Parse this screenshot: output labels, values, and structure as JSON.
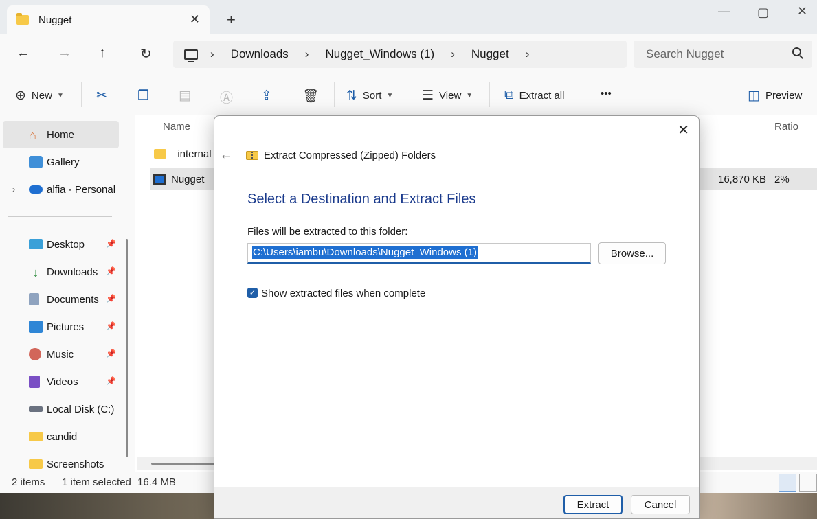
{
  "tab": {
    "title": "Nugget"
  },
  "breadcrumb": [
    "Downloads",
    "Nugget_Windows (1)",
    "Nugget"
  ],
  "search": {
    "placeholder": "Search Nugget"
  },
  "toolbar": {
    "new_label": "New",
    "sort_label": "Sort",
    "view_label": "View",
    "extract_all_label": "Extract all",
    "more_label": "•••",
    "preview_label": "Preview"
  },
  "sidebar": {
    "items": [
      {
        "label": "Home",
        "icon": "home-icon"
      },
      {
        "label": "Gallery",
        "icon": "gallery-icon"
      },
      {
        "label": "alfia - Personal",
        "icon": "onedrive-icon"
      },
      {
        "label": "Desktop",
        "icon": "desktop-icon"
      },
      {
        "label": "Downloads",
        "icon": "downloads-icon"
      },
      {
        "label": "Documents",
        "icon": "documents-icon"
      },
      {
        "label": "Pictures",
        "icon": "pictures-icon"
      },
      {
        "label": "Music",
        "icon": "music-icon"
      },
      {
        "label": "Videos",
        "icon": "videos-icon"
      },
      {
        "label": "Local Disk (C:)",
        "icon": "drive-icon"
      },
      {
        "label": "candid",
        "icon": "folder-icon"
      },
      {
        "label": "Screenshots",
        "icon": "folder-icon"
      }
    ]
  },
  "filelist": {
    "columns": {
      "name": "Name",
      "ratio": "Ratio"
    },
    "rows": [
      {
        "name": "_internal",
        "size": "",
        "ratio": ""
      },
      {
        "name": "Nugget",
        "size": "16,870 KB",
        "ratio": "2%"
      }
    ]
  },
  "status": {
    "count": "2 items",
    "selected": "1 item selected",
    "size": "16.4 MB"
  },
  "dialog": {
    "title": "Extract Compressed (Zipped) Folders",
    "heading": "Select a Destination and Extract Files",
    "label": "Files will be extracted to this folder:",
    "path": "C:\\Users\\iambu\\Downloads\\Nugget_Windows (1)",
    "browse_label": "Browse...",
    "checkbox_label": "Show extracted files when complete",
    "checkbox_checked": true,
    "extract_label": "Extract",
    "cancel_label": "Cancel"
  },
  "colors": {
    "accent": "#1f5ea8",
    "heading": "#1a3a8c",
    "folder": "#f7c948"
  }
}
